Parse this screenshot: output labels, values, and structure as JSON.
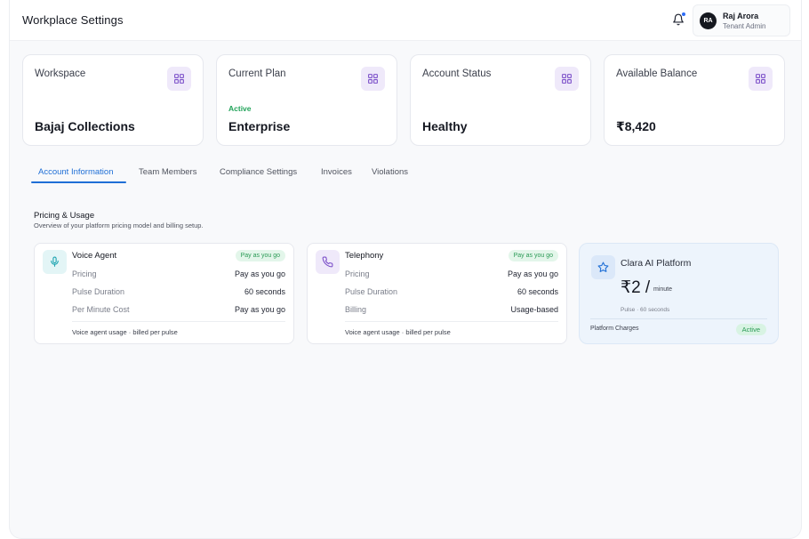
{
  "header": {
    "title": "Workplace Settings",
    "user": {
      "initials": "RA",
      "name": "Raj Arora",
      "role": "Tenant Admin"
    }
  },
  "stats": [
    {
      "label": "Workspace",
      "sub": "",
      "value": "Bajaj Collections"
    },
    {
      "label": "Current Plan",
      "sub": "Active",
      "value": "Enterprise"
    },
    {
      "label": "Account Status",
      "sub": "",
      "value": "Healthy"
    },
    {
      "label": "Available Balance",
      "sub": "",
      "value": "₹8,420"
    }
  ],
  "tabs": [
    {
      "label": "Account Information",
      "active": true
    },
    {
      "label": "Team Members",
      "active": false
    },
    {
      "label": "Compliance Settings",
      "active": false
    },
    {
      "label": "Invoices",
      "active": false
    },
    {
      "label": "Violations",
      "active": false
    }
  ],
  "section": {
    "title": "Pricing & Usage",
    "description": "Overview of your platform pricing model and billing setup."
  },
  "pricing_cards": [
    {
      "title": "Voice Agent",
      "badge": "Pay as you go",
      "icon": "microphone-icon",
      "rows": [
        {
          "key": "Pricing",
          "value": "Pay as you go"
        },
        {
          "key": "Pulse Duration",
          "value": "60 seconds"
        },
        {
          "key": "Per Minute Cost",
          "value": "Pay as you go"
        }
      ],
      "footer": "Voice agent usage · billed per pulse"
    },
    {
      "title": "Telephony",
      "badge": "Pay as you go",
      "icon": "phone-icon",
      "rows": [
        {
          "key": "Pricing",
          "value": "Pay as you go"
        },
        {
          "key": "Pulse Duration",
          "value": "60 seconds"
        },
        {
          "key": "Billing",
          "value": "Usage-based"
        }
      ],
      "footer": "Voice agent usage · billed per pulse"
    }
  ],
  "platform": {
    "title": "Clara AI Platform",
    "price": "₹2 /",
    "unit": "minute",
    "pulse": "Pulse · 60 seconds",
    "footer_label": "Platform Charges",
    "badge": "Active",
    "icon": "star-icon"
  },
  "colors": {
    "accent": "#1f6fd6",
    "success": "#2a9a55",
    "notification": "#2f6df6",
    "icon_bg_purple": "#efe9fa",
    "platform_bg": "#edf4fc"
  }
}
